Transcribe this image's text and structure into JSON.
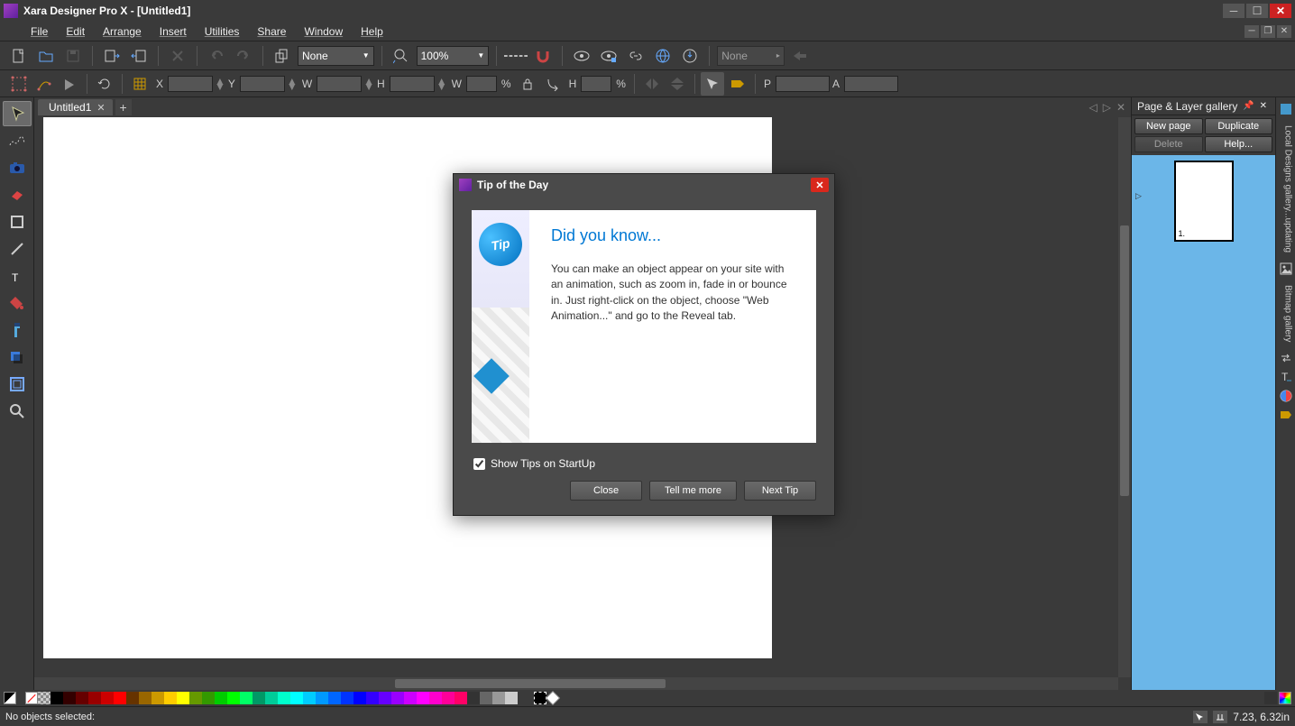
{
  "app": {
    "title": "Xara Designer Pro X - [Untitled1]"
  },
  "menu": [
    "File",
    "Edit",
    "Arrange",
    "Insert",
    "Utilities",
    "Share",
    "Window",
    "Help"
  ],
  "toolbar1": {
    "profile_combo": "None",
    "zoom_value": "100%",
    "name_combo": "None"
  },
  "info_bar": {
    "X": "",
    "Y": "",
    "W1": "",
    "H1": "",
    "W2": "",
    "H2": "",
    "pct1": "%",
    "pct2": "%",
    "P": "",
    "A": ""
  },
  "doc_tab": {
    "label": "Untitled1"
  },
  "gallery": {
    "title": "Page & Layer gallery",
    "buttons": {
      "new_page": "New  page",
      "duplicate": "Duplicate",
      "delete": "Delete",
      "help": "Help..."
    },
    "page_number": "1."
  },
  "side_tabs": [
    "Local Designs gallery...updating",
    "Bitmap gallery"
  ],
  "status": {
    "text": "No objects selected:",
    "coords": "7.23, 6.32in"
  },
  "dialog": {
    "title": "Tip of the Day",
    "tip_badge": "Tip",
    "heading": "Did you know...",
    "body": "You can make an object appear on your site with an animation, such as zoom in, fade in or bounce in. Just right-click on the object, choose \"Web Animation...\" and go to the Reveal tab.",
    "show_tips_label": "Show Tips on StartUp",
    "buttons": {
      "close": "Close",
      "more": "Tell me more",
      "next": "Next Tip"
    }
  },
  "colors": [
    "#000000",
    "#330000",
    "#660000",
    "#990000",
    "#cc0000",
    "#ff0000",
    "#663300",
    "#996600",
    "#cc9900",
    "#ffcc00",
    "#ffff00",
    "#669900",
    "#339900",
    "#00cc00",
    "#00ff00",
    "#00ff66",
    "#009966",
    "#00cc99",
    "#00ffcc",
    "#00ffff",
    "#00ccff",
    "#0099ff",
    "#0066ff",
    "#0033ff",
    "#0000ff",
    "#3300ff",
    "#6600ff",
    "#9900ff",
    "#cc00ff",
    "#ff00ff",
    "#ff00cc",
    "#ff0099",
    "#ff0066",
    "#333333",
    "#666666",
    "#999999",
    "#cccccc"
  ]
}
